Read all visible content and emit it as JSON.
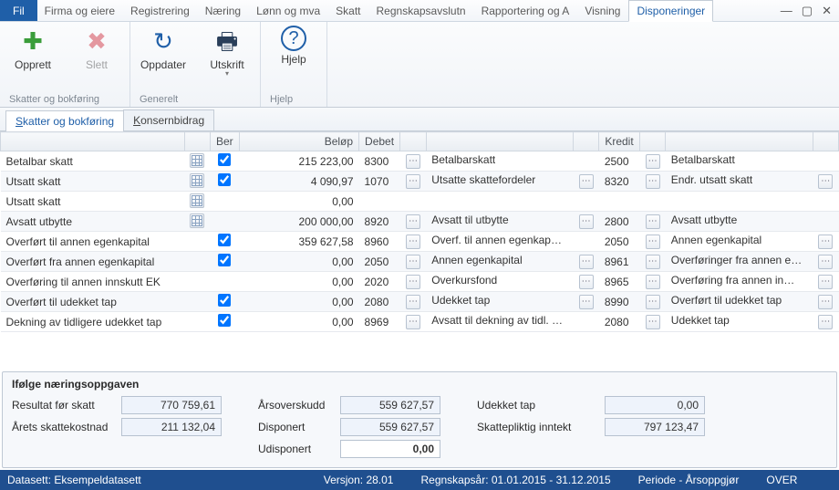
{
  "menubar": {
    "file": "Fil",
    "tabs": [
      "Firma og eiere",
      "Registrering",
      "Næring",
      "Lønn og mva",
      "Skatt",
      "Regnskapsavslutn",
      "Rapportering og A",
      "Visning",
      "Disponeringer"
    ],
    "active_index": 8
  },
  "ribbon": {
    "groups": [
      {
        "name": "Skatter og bokføring",
        "items": [
          {
            "label": "Opprett",
            "icon": "plus-icon",
            "enabled": true
          },
          {
            "label": "Slett",
            "icon": "x-icon",
            "enabled": false
          }
        ]
      },
      {
        "name": "Generelt",
        "items": [
          {
            "label": "Oppdater",
            "icon": "refresh-icon",
            "enabled": true
          },
          {
            "label": "Utskrift",
            "icon": "printer-icon",
            "enabled": true,
            "dropdown": true
          }
        ]
      },
      {
        "name": "Hjelp",
        "items": [
          {
            "label": "Hjelp",
            "icon": "help-icon",
            "enabled": true
          }
        ]
      }
    ]
  },
  "subtabs": {
    "items": [
      {
        "accel": "S",
        "rest": "katter og bokføring"
      },
      {
        "accel": "K",
        "rest": "onsernbidrag"
      }
    ],
    "active_index": 0
  },
  "columns": {
    "ber": "Ber",
    "belop": "Beløp",
    "debet": "Debet",
    "kredit": "Kredit"
  },
  "rows": [
    {
      "label": "Betalbar skatt",
      "has_grid": true,
      "ber": true,
      "belop": "215 223,00",
      "debet_acct": "8300",
      "debet_name": "Betalbarskatt",
      "kredit_acct": "2500",
      "kredit_name": "Betalbarskatt",
      "d_more": false,
      "k_more": false
    },
    {
      "label": "Utsatt skatt",
      "has_grid": true,
      "ber": true,
      "belop": "4 090,97",
      "debet_acct": "1070",
      "debet_name": "Utsatte skattefordeler",
      "kredit_acct": "8320",
      "kredit_name": "Endr. utsatt skatt",
      "d_more": true,
      "k_more": true
    },
    {
      "label": "Utsatt skatt",
      "has_grid": true,
      "ber": false,
      "ber_hidden": true,
      "belop": "0,00",
      "debet_acct": "",
      "debet_name": "",
      "kredit_acct": "",
      "kredit_name": "",
      "d_more": false,
      "k_more": false
    },
    {
      "label": "Avsatt utbytte",
      "has_grid": true,
      "ber": false,
      "ber_hidden": true,
      "belop": "200 000,00",
      "debet_acct": "8920",
      "debet_name": "Avsatt til utbytte",
      "kredit_acct": "2800",
      "kredit_name": "Avsatt utbytte",
      "d_more": true,
      "k_more": false
    },
    {
      "label": "Overført til annen egenkapital",
      "has_grid": false,
      "ber": true,
      "belop": "359 627,58",
      "debet_acct": "8960",
      "debet_name": "Overf. til annen egenkap…",
      "kredit_acct": "2050",
      "kredit_name": "Annen egenkapital",
      "d_more": false,
      "k_more": true
    },
    {
      "label": "Overført fra annen egenkapital",
      "has_grid": false,
      "ber": true,
      "belop": "0,00",
      "debet_acct": "2050",
      "debet_name": "Annen egenkapital",
      "kredit_acct": "8961",
      "kredit_name": "Overføringer fra annen e…",
      "d_more": true,
      "k_more": true
    },
    {
      "label": "Overføring til annen innskutt EK",
      "has_grid": false,
      "ber": false,
      "ber_hidden": true,
      "belop": "0,00",
      "debet_acct": "2020",
      "debet_name": "Overkursfond",
      "kredit_acct": "8965",
      "kredit_name": "Overføring fra annen in…",
      "d_more": true,
      "k_more": true
    },
    {
      "label": "Overført til udekket tap",
      "has_grid": false,
      "ber": true,
      "belop": "0,00",
      "debet_acct": "2080",
      "debet_name": "Udekket tap",
      "kredit_acct": "8990",
      "kredit_name": "Overført til udekket tap",
      "d_more": true,
      "k_more": true
    },
    {
      "label": "Dekning av tidligere udekket tap",
      "has_grid": false,
      "ber": true,
      "belop": "0,00",
      "debet_acct": "8969",
      "debet_name": "Avsatt til dekning av tidl. …",
      "kredit_acct": "2080",
      "kredit_name": "Udekket tap",
      "d_more": false,
      "k_more": true
    }
  ],
  "summary": {
    "title": "Ifølge næringsoppgaven",
    "resultat_label": "Resultat før skatt",
    "resultat": "770 759,61",
    "skattekost_label": "Årets skattekostnad",
    "skattekost": "211 132,04",
    "arsoverskudd_label": "Årsoverskudd",
    "arsoverskudd": "559 627,57",
    "disponert_label": "Disponert",
    "disponert": "559 627,57",
    "udisponert_label": "Udisponert",
    "udisponert": "0,00",
    "udekket_label": "Udekket tap",
    "udekket": "0,00",
    "skattepliktig_label": "Skattepliktig inntekt",
    "skattepliktig": "797 123,47"
  },
  "statusbar": {
    "dataset": "Datasett: Eksempeldatasett",
    "version": "Versjon: 28.01",
    "year": "Regnskapsår: 01.01.2015 - 31.12.2015",
    "period": "Periode - Årsoppgjør",
    "over": "OVER"
  }
}
